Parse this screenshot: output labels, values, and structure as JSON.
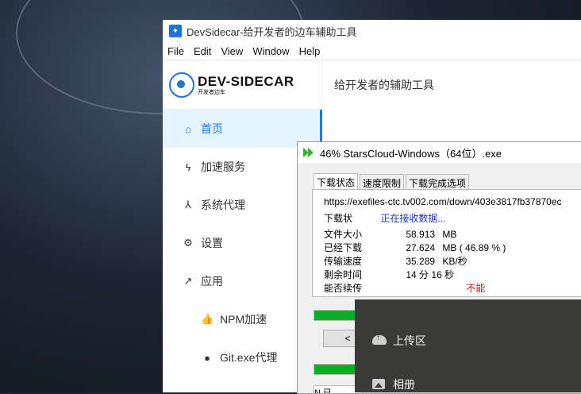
{
  "main_window": {
    "title": "DevSidecar-给开发者的边车辅助工具",
    "menu": [
      "File",
      "Edit",
      "View",
      "Window",
      "Help"
    ],
    "logo_main": "DEV-SIDECAR",
    "logo_sub": "开发者边车",
    "header": "给开发者的辅助工具",
    "nav": [
      {
        "label": "首页",
        "icon": "home-icon"
      },
      {
        "label": "加速服务",
        "icon": "lightning-icon"
      },
      {
        "label": "系统代理",
        "icon": "network-icon"
      },
      {
        "label": "设置",
        "icon": "gear-icon"
      },
      {
        "label": "应用",
        "icon": "rocket-icon"
      },
      {
        "label": "NPM加速",
        "icon": "thumbs-up-icon"
      },
      {
        "label": "Git.exe代理",
        "icon": "github-icon"
      }
    ]
  },
  "download": {
    "title": "46% StarsCloud-Windows（64位）.exe",
    "tabs": [
      "下载状态",
      "速度限制",
      "下载完成选项"
    ],
    "url": "https://exefiles-ctc.tv002.com/down/403e3817fb37870ec",
    "status_label": "下载状",
    "status_value": "正在接收数据...",
    "file_size_label": "文件大小",
    "file_size_value": "58.913",
    "file_size_unit": "MB",
    "downloaded_label": "已经下载",
    "downloaded_value": "27.624",
    "downloaded_unit": "MB ( 46.89 % )",
    "speed_label": "传输速度",
    "speed_value": "35.289",
    "speed_unit": "KB/秒",
    "remaining_label": "剩余时间",
    "remaining_value": "14 分 16 秒",
    "resume_label": "能否续传",
    "resume_value": "不能",
    "progress": 0.4689,
    "cancel_label": "<",
    "list_header": "N  已"
  },
  "upload_panel": {
    "items": [
      {
        "label": "上传区",
        "icon": "cloud-upload-icon"
      },
      {
        "label": "相册",
        "icon": "photo-icon"
      }
    ]
  },
  "colors": {
    "accent": "#1677ff",
    "progress_green": "#06b025",
    "status_blue": "#1a33c9",
    "warning_red": "#d4100d"
  }
}
